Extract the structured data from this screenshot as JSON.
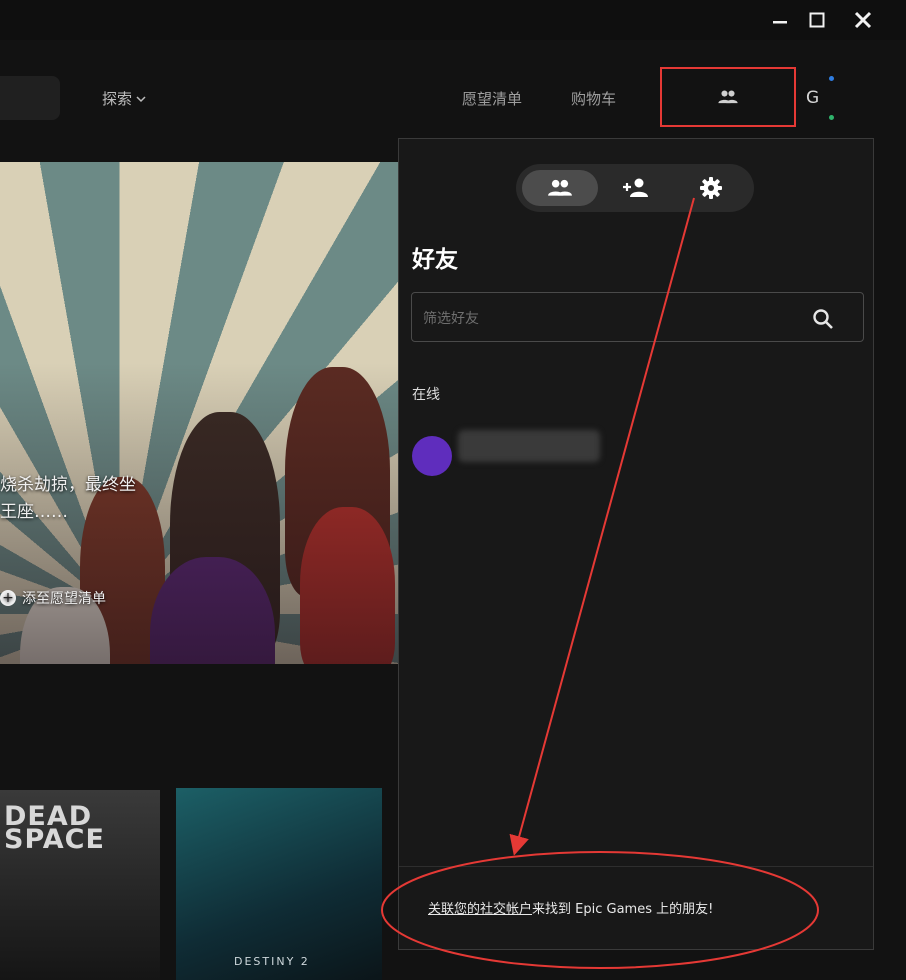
{
  "window_controls": {
    "minimize": "–",
    "maximize": "☐",
    "close": "✕"
  },
  "nav": {
    "explore": "探索",
    "wishlist": "愿望清单",
    "cart": "购物车",
    "avatar_initial": "G"
  },
  "hero": {
    "line1": "烧杀劫掠，最终坐",
    "line2": "王座……",
    "add_wishlist": "添至愿望清单"
  },
  "tiles": {
    "dead_space_line1": "DEAD",
    "dead_space_line2": "SPACE",
    "destiny": "DESTINY 2"
  },
  "friends_panel": {
    "title": "好友",
    "filter_placeholder": "筛选好友",
    "online_section": "在线",
    "link_text": "关联您的社交帐户",
    "link_suffix": "来找到 Epic Games 上的朋友!"
  },
  "icons": {
    "tab_friends": "people-icon",
    "tab_add": "person-add-icon",
    "tab_settings": "gear-icon",
    "filter": "search-icon"
  },
  "colors": {
    "annotation": "#e53935",
    "panel_bg": "#181818",
    "avatar": "#5f2dbd"
  }
}
